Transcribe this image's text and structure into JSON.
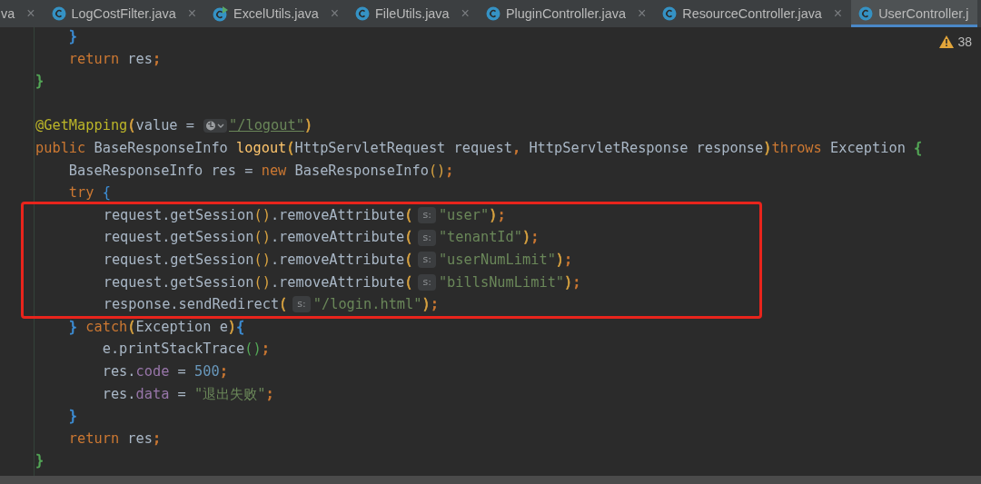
{
  "tabs": [
    {
      "kind": "plain",
      "label": "va",
      "close": "×",
      "selected": false
    },
    {
      "kind": "class",
      "label": "LogCostFilter.java",
      "close": "×",
      "selected": false
    },
    {
      "kind": "runnable-class",
      "label": "ExcelUtils.java",
      "close": "×",
      "selected": false
    },
    {
      "kind": "class",
      "label": "FileUtils.java",
      "close": "×",
      "selected": false
    },
    {
      "kind": "class",
      "label": "PluginController.java",
      "close": "×",
      "selected": false
    },
    {
      "kind": "class",
      "label": "ResourceController.java",
      "close": "×",
      "selected": false
    },
    {
      "kind": "class",
      "label": "UserController.j",
      "selected": true
    }
  ],
  "problems": {
    "warnings": "38"
  },
  "code_lines": [
    {
      "highlighted": false,
      "tokens": [
        {
          "text": "    }",
          "color": "#3d8fd8"
        }
      ]
    },
    {
      "highlighted": false,
      "tokens": [
        {
          "text": "    return",
          "color": "#cc7832"
        },
        {
          "text": " res",
          "color": "#a9b7c6"
        },
        {
          "text": ";",
          "color": "#cc7832"
        }
      ]
    },
    {
      "highlighted": false,
      "tokens": [
        {
          "text": "}",
          "color": "#54a857"
        }
      ]
    },
    {
      "highlighted": false
    },
    {
      "highlighted": false,
      "tokens": [
        {
          "text": "@GetMapping",
          "color": "#bbb529"
        },
        {
          "text": "(",
          "color": "#d9a340"
        },
        {
          "text": "value =",
          "color": "#a9b7c6"
        },
        {
          "kind": "globe"
        },
        {
          "kind": "link",
          "text": "\"/logout\"",
          "color": "#6a8759"
        },
        {
          "text": ")",
          "color": "#d9a340"
        }
      ]
    },
    {
      "highlighted": false,
      "tokens": [
        {
          "text": "public",
          "color": "#cc7832"
        },
        {
          "text": " BaseResponseInfo ",
          "color": "#a9b7c6"
        },
        {
          "text": "logout",
          "color": "#ffc66d"
        },
        {
          "text": "(",
          "color": "#d9a340"
        },
        {
          "text": "HttpServletRequest request",
          "color": "#a9b7c6"
        },
        {
          "text": ",",
          "color": "#cc7832"
        },
        {
          "text": " HttpServletResponse response",
          "color": "#a9b7c6"
        },
        {
          "text": ")",
          "color": "#d9a340"
        },
        {
          "text": "throws",
          "color": "#cc7832"
        },
        {
          "text": " Exception ",
          "color": "#a9b7c6"
        },
        {
          "text": "{",
          "color": "#54a857"
        }
      ]
    },
    {
      "highlighted": false,
      "tokens": [
        {
          "text": "    BaseResponseInfo res = ",
          "color": "#a9b7c6"
        },
        {
          "text": "new",
          "color": "#cc7832"
        },
        {
          "text": " BaseResponseInfo",
          "color": "#a9b7c6"
        },
        {
          "text": "()",
          "color": "#d9a340"
        },
        {
          "text": ";",
          "color": "#cc7832"
        }
      ]
    },
    {
      "highlighted": false,
      "tokens": [
        {
          "text": "    try",
          "color": "#cc7832"
        },
        {
          "text": " {",
          "color": "#3d8fd8"
        }
      ]
    },
    {
      "highlighted": true,
      "tokens": [
        {
          "text": "        request.getSession",
          "color": "#a9b7c6"
        },
        {
          "text": "()",
          "color": "#d9a340"
        },
        {
          "text": ".removeAttribute",
          "color": "#a9b7c6"
        },
        {
          "text": "(",
          "color": "#d9a340"
        },
        {
          "kind": "hint",
          "text": "s:"
        },
        {
          "text": "\"user\"",
          "color": "#6a8759"
        },
        {
          "text": ")",
          "color": "#d9a340"
        },
        {
          "text": ";",
          "color": "#cc7832"
        }
      ]
    },
    {
      "highlighted": true,
      "tokens": [
        {
          "text": "        request.getSession",
          "color": "#a9b7c6"
        },
        {
          "text": "()",
          "color": "#d9a340"
        },
        {
          "text": ".removeAttribute",
          "color": "#a9b7c6"
        },
        {
          "text": "(",
          "color": "#d9a340"
        },
        {
          "kind": "hint",
          "text": "s:"
        },
        {
          "text": "\"tenantId\"",
          "color": "#6a8759"
        },
        {
          "text": ")",
          "color": "#d9a340"
        },
        {
          "text": ";",
          "color": "#cc7832"
        }
      ]
    },
    {
      "highlighted": true,
      "tokens": [
        {
          "text": "        request.getSession",
          "color": "#a9b7c6"
        },
        {
          "text": "()",
          "color": "#d9a340"
        },
        {
          "text": ".removeAttribute",
          "color": "#a9b7c6"
        },
        {
          "text": "(",
          "color": "#d9a340"
        },
        {
          "kind": "hint",
          "text": "s:"
        },
        {
          "text": "\"userNumLimit\"",
          "color": "#6a8759"
        },
        {
          "text": ")",
          "color": "#d9a340"
        },
        {
          "text": ";",
          "color": "#cc7832"
        }
      ]
    },
    {
      "highlighted": true,
      "tokens": [
        {
          "text": "        request.getSession",
          "color": "#a9b7c6"
        },
        {
          "text": "()",
          "color": "#d9a340"
        },
        {
          "text": ".removeAttribute",
          "color": "#a9b7c6"
        },
        {
          "text": "(",
          "color": "#d9a340"
        },
        {
          "kind": "hint",
          "text": "s:"
        },
        {
          "text": "\"billsNumLimit\"",
          "color": "#6a8759"
        },
        {
          "text": ")",
          "color": "#d9a340"
        },
        {
          "text": ";",
          "color": "#cc7832"
        }
      ]
    },
    {
      "highlighted": true,
      "tokens": [
        {
          "text": "        response.sendRedirect",
          "color": "#a9b7c6"
        },
        {
          "text": "(",
          "color": "#d9a340"
        },
        {
          "kind": "hint",
          "text": "s:"
        },
        {
          "text": "\"/login.html\"",
          "color": "#6a8759"
        },
        {
          "text": ")",
          "color": "#d9a340"
        },
        {
          "text": ";",
          "color": "#cc7832"
        }
      ]
    },
    {
      "highlighted": false,
      "tokens": [
        {
          "text": "    }",
          "color": "#3d8fd8"
        },
        {
          "text": " catch",
          "color": "#cc7832"
        },
        {
          "text": "(",
          "color": "#d9a340"
        },
        {
          "text": "Exception e",
          "color": "#a9b7c6"
        },
        {
          "text": ")",
          "color": "#d9a340"
        },
        {
          "text": "{",
          "color": "#3d8fd8"
        }
      ]
    },
    {
      "highlighted": false,
      "tokens": [
        {
          "text": "        e.printStackTrace",
          "color": "#a9b7c6"
        },
        {
          "text": "()",
          "color": "#54a857"
        },
        {
          "text": ";",
          "color": "#cc7832"
        }
      ]
    },
    {
      "highlighted": false,
      "tokens": [
        {
          "text": "        res.",
          "color": "#a9b7c6"
        },
        {
          "text": "code",
          "color": "#9876aa"
        },
        {
          "text": " = ",
          "color": "#a9b7c6"
        },
        {
          "text": "500",
          "color": "#6897bb"
        },
        {
          "text": ";",
          "color": "#cc7832"
        }
      ]
    },
    {
      "highlighted": false,
      "tokens": [
        {
          "text": "        res.",
          "color": "#a9b7c6"
        },
        {
          "text": "data",
          "color": "#9876aa"
        },
        {
          "text": " = ",
          "color": "#a9b7c6"
        },
        {
          "text": "\"退出失败\"",
          "color": "#6a8759"
        },
        {
          "text": ";",
          "color": "#cc7832"
        }
      ]
    },
    {
      "highlighted": false,
      "tokens": [
        {
          "text": "    }",
          "color": "#3d8fd8"
        }
      ]
    },
    {
      "highlighted": false,
      "tokens": [
        {
          "text": "    return",
          "color": "#cc7832"
        },
        {
          "text": " res",
          "color": "#a9b7c6"
        },
        {
          "text": ";",
          "color": "#cc7832"
        }
      ]
    },
    {
      "highlighted": false,
      "tokens": [
        {
          "text": "}",
          "color": "#54a857"
        }
      ]
    }
  ]
}
